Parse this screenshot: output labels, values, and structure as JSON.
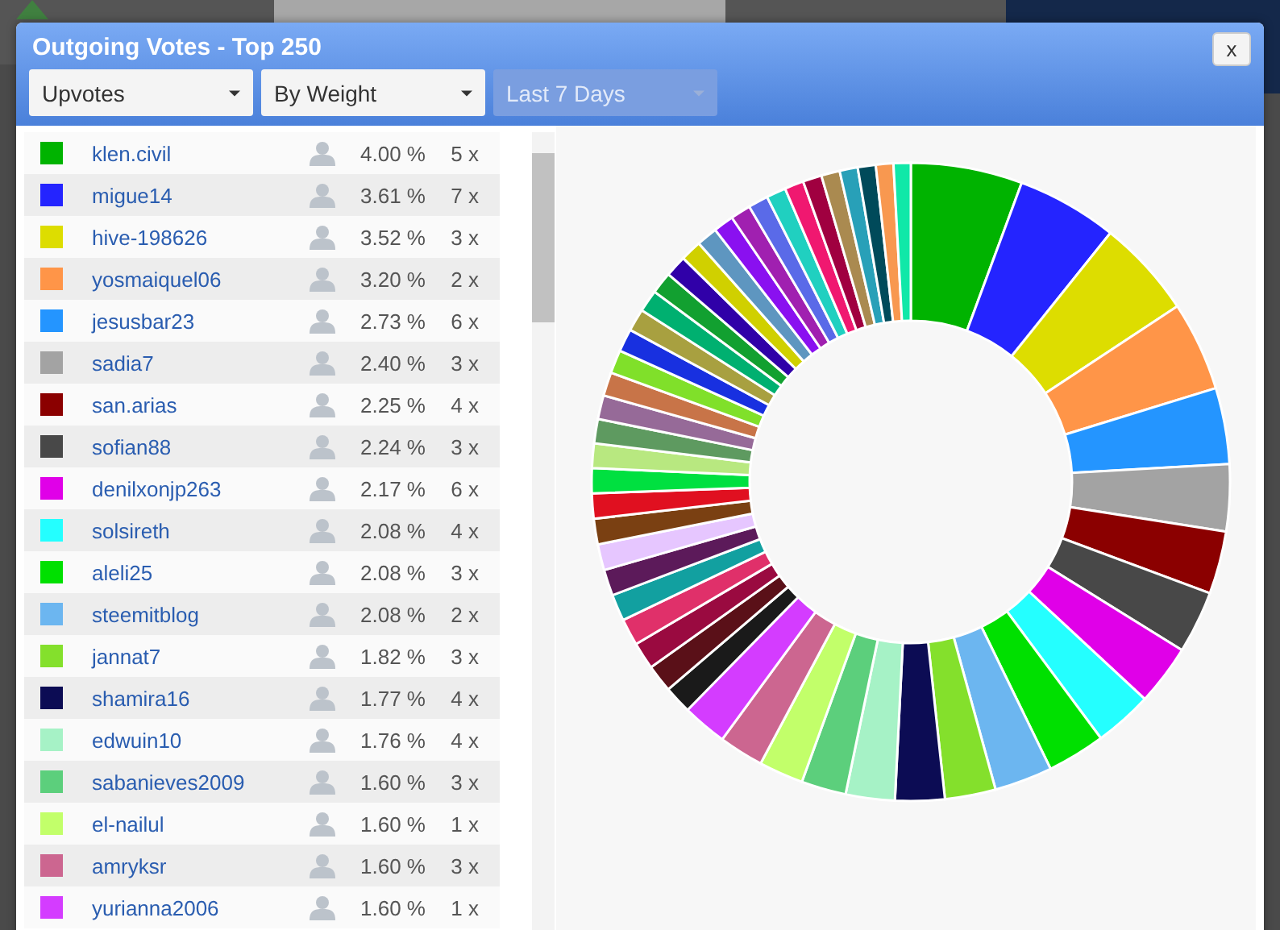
{
  "dialog": {
    "title": "Outgoing Votes - Top 250",
    "close_label": "x",
    "filters": [
      {
        "label": "Upvotes",
        "disabled": false
      },
      {
        "label": "By Weight",
        "disabled": false
      },
      {
        "label": "Last 7 Days",
        "disabled": true
      }
    ],
    "voters": [
      {
        "color": "#00b300",
        "name": "klen.civil",
        "percent": "4.00 %",
        "count": "5 x"
      },
      {
        "color": "#2424ff",
        "name": "migue14",
        "percent": "3.61 %",
        "count": "7 x"
      },
      {
        "color": "#dddd00",
        "name": "hive-198626",
        "percent": "3.52 %",
        "count": "3 x"
      },
      {
        "color": "#ff9548",
        "name": "yosmaiquel06",
        "percent": "3.20 %",
        "count": "2 x"
      },
      {
        "color": "#2495ff",
        "name": "jesusbar23",
        "percent": "2.73 %",
        "count": "6 x"
      },
      {
        "color": "#a3a3a3",
        "name": "sadia7",
        "percent": "2.40 %",
        "count": "3 x"
      },
      {
        "color": "#8b0000",
        "name": "san.arias",
        "percent": "2.25 %",
        "count": "4 x"
      },
      {
        "color": "#484848",
        "name": "sofian88",
        "percent": "2.24 %",
        "count": "3 x"
      },
      {
        "color": "#e000e8",
        "name": "denilxonjp263",
        "percent": "2.17 %",
        "count": "6 x"
      },
      {
        "color": "#24ffff",
        "name": "solsireth",
        "percent": "2.08 %",
        "count": "4 x"
      },
      {
        "color": "#00e000",
        "name": "aleli25",
        "percent": "2.08 %",
        "count": "3 x"
      },
      {
        "color": "#6cb6f0",
        "name": "steemitblog",
        "percent": "2.08 %",
        "count": "2 x"
      },
      {
        "color": "#84e02c",
        "name": "jannat7",
        "percent": "1.82 %",
        "count": "3 x"
      },
      {
        "color": "#0c0c54",
        "name": "shamira16",
        "percent": "1.77 %",
        "count": "4 x"
      },
      {
        "color": "#a6f2c6",
        "name": "edwuin10",
        "percent": "1.76 %",
        "count": "4 x"
      },
      {
        "color": "#5ccf7c",
        "name": "sabanieves2009",
        "percent": "1.60 %",
        "count": "3 x"
      },
      {
        "color": "#c2ff6a",
        "name": "el-nailul",
        "percent": "1.60 %",
        "count": "1 x"
      },
      {
        "color": "#cc6690",
        "name": "amryksr",
        "percent": "1.60 %",
        "count": "3 x"
      },
      {
        "color": "#d43cff",
        "name": "yurianna2006",
        "percent": "1.60 %",
        "count": "1 x"
      }
    ]
  }
}
